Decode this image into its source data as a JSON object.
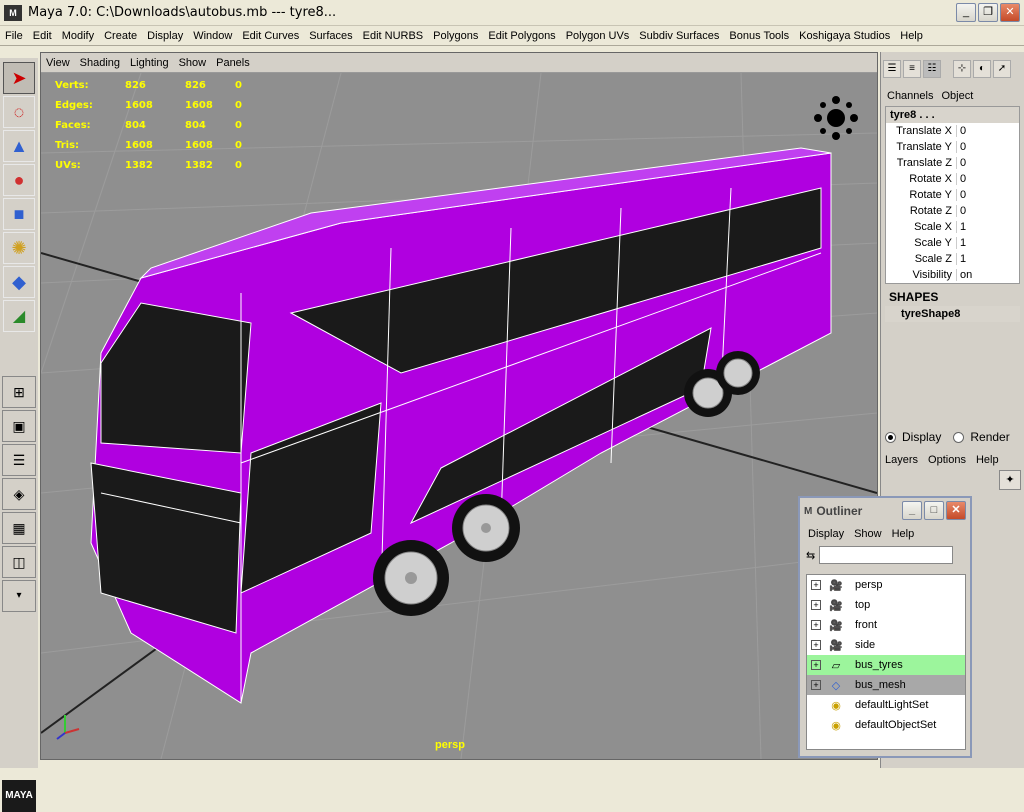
{
  "window": {
    "title": "Maya 7.0: C:\\Downloads\\autobus.mb  ---   tyre8...",
    "logo": "M"
  },
  "menubar": [
    "File",
    "Edit",
    "Modify",
    "Create",
    "Display",
    "Window",
    "Edit Curves",
    "Surfaces",
    "Edit NURBS",
    "Polygons",
    "Edit Polygons",
    "Polygon UVs",
    "Subdiv Surfaces",
    "Bonus Tools",
    "Koshigaya Studios",
    "Help"
  ],
  "viewport": {
    "menu": [
      "View",
      "Shading",
      "Lighting",
      "Show",
      "Panels"
    ],
    "camera": "persp",
    "stats": [
      {
        "label": "Verts:",
        "a": "826",
        "b": "826",
        "c": "0"
      },
      {
        "label": "Edges:",
        "a": "1608",
        "b": "1608",
        "c": "0"
      },
      {
        "label": "Faces:",
        "a": "804",
        "b": "804",
        "c": "0"
      },
      {
        "label": "Tris:",
        "a": "1608",
        "b": "1608",
        "c": "0"
      },
      {
        "label": "UVs:",
        "a": "1382",
        "b": "1382",
        "c": "0"
      }
    ],
    "bus_color": "#b000e0"
  },
  "channelbox": {
    "tabs": [
      "Channels",
      "Object"
    ],
    "node": "tyre8 . . .",
    "attrs": [
      {
        "name": "Translate X",
        "value": "0"
      },
      {
        "name": "Translate Y",
        "value": "0"
      },
      {
        "name": "Translate Z",
        "value": "0"
      },
      {
        "name": "Rotate X",
        "value": "0"
      },
      {
        "name": "Rotate Y",
        "value": "0"
      },
      {
        "name": "Rotate Z",
        "value": "0"
      },
      {
        "name": "Scale X",
        "value": "1"
      },
      {
        "name": "Scale Y",
        "value": "1"
      },
      {
        "name": "Scale Z",
        "value": "1"
      },
      {
        "name": "Visibility",
        "value": "on"
      }
    ],
    "shapes_header": "SHAPES",
    "shape": "tyreShape8"
  },
  "layers": {
    "display_label": "Display",
    "render_label": "Render",
    "menu": [
      "Layers",
      "Options",
      "Help"
    ]
  },
  "outliner": {
    "title": "Outliner",
    "menu": [
      "Display",
      "Show",
      "Help"
    ],
    "items": [
      {
        "label": "persp"
      },
      {
        "label": "top"
      },
      {
        "label": "front"
      },
      {
        "label": "side"
      },
      {
        "label": "bus_tyres"
      },
      {
        "label": "bus_mesh"
      },
      {
        "label": "defaultLightSet"
      },
      {
        "label": "defaultObjectSet"
      }
    ]
  }
}
